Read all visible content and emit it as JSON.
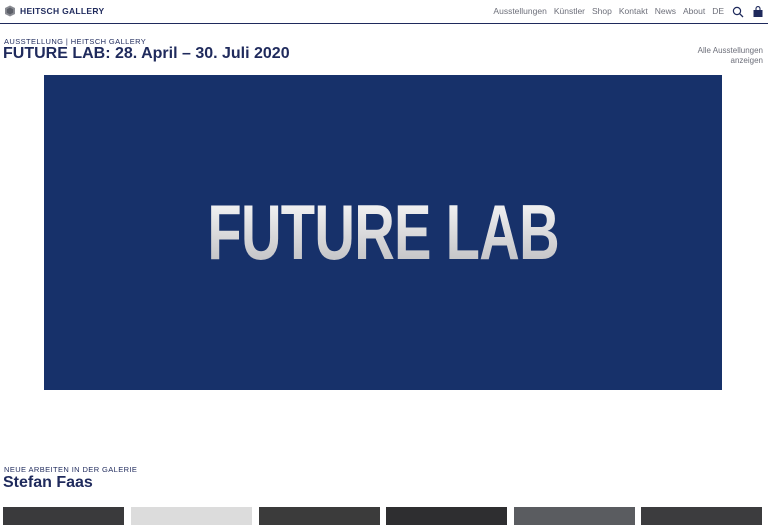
{
  "header": {
    "brand": "HEITSCH GALLERY",
    "nav": [
      "Ausstellungen",
      "Künstler",
      "Shop",
      "Kontakt",
      "News",
      "About",
      "DE"
    ],
    "icons": [
      "search-icon",
      "bag-icon"
    ]
  },
  "exhibition": {
    "eyebrow": "AUSSTELLUNG | HEITSCH GALLERY",
    "title": "FUTURE LAB: 28. April – 30. Juli 2020",
    "all_link": "Alle Ausstellungen anzeigen",
    "hero_text": "FUTURE LAB"
  },
  "new_works": {
    "eyebrow": "NEUE ARBEITEN IN DER GALERIE",
    "artist": "Stefan Faas",
    "thumbnails": [
      {
        "color": "#3a3a3c"
      },
      {
        "color": "#dcdcdc"
      },
      {
        "color": "#3b3b3b"
      },
      {
        "color": "#2e2e30"
      },
      {
        "color": "#5a5c60"
      },
      {
        "color": "#3c3c3e"
      }
    ]
  },
  "colors": {
    "brand": "#1f2a5c",
    "hero_bg": "#17316a",
    "nav_text": "#6d6f7a"
  }
}
